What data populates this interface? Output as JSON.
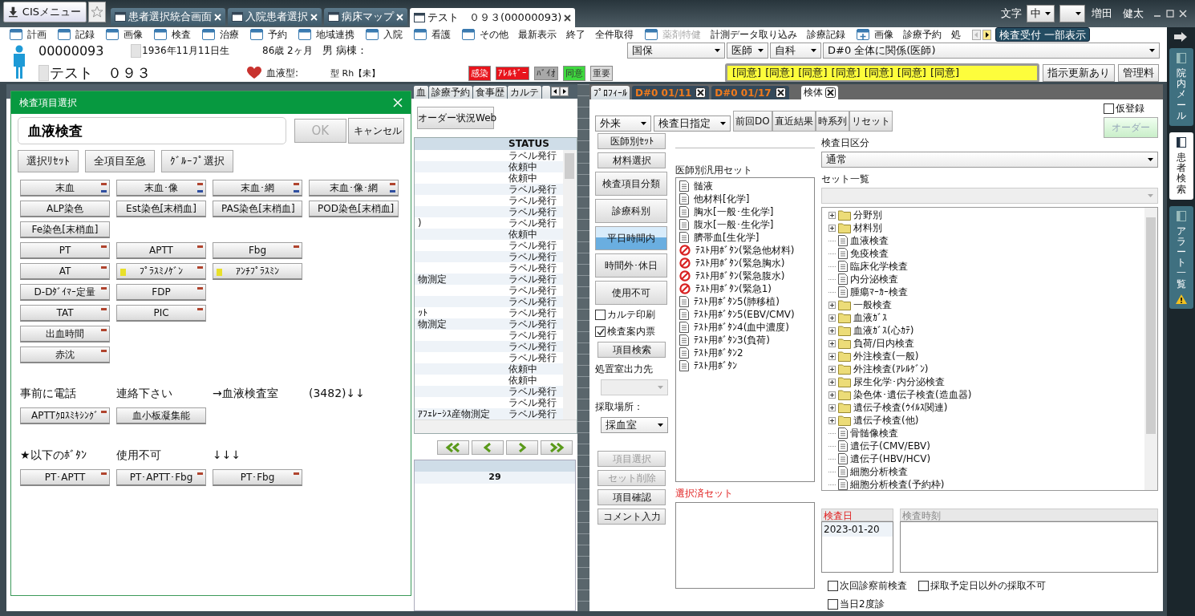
{
  "title_bar": {
    "menu_button": "CISメニュー",
    "tabs": [
      {
        "label": "患者選択統合画面",
        "selected": false
      },
      {
        "label": "入院患者選択",
        "selected": false
      },
      {
        "label": "病床マップ",
        "selected": false
      },
      {
        "label": "テスト　０９３(00000093)",
        "selected": true
      }
    ],
    "font_label": "文字",
    "font_size": "中",
    "user": "増田　健太"
  },
  "menu": [
    {
      "label": "計画",
      "kind": "window",
      "disabled": false
    },
    {
      "label": "記録",
      "kind": "window",
      "disabled": false
    },
    {
      "label": "画像",
      "kind": "window",
      "disabled": false
    },
    {
      "label": "検査",
      "kind": "window",
      "disabled": false
    },
    {
      "label": "治療",
      "kind": "window",
      "disabled": false
    },
    {
      "label": "予約",
      "kind": "window",
      "disabled": false
    },
    {
      "label": "地域連携",
      "kind": "window",
      "disabled": false
    },
    {
      "label": "入院",
      "kind": "window",
      "disabled": false
    },
    {
      "label": "看護",
      "kind": "window",
      "disabled": false
    },
    {
      "label": "その他",
      "kind": "window",
      "disabled": false
    },
    {
      "label": "最新表示",
      "kind": "text",
      "disabled": false
    },
    {
      "label": "終了",
      "kind": "text",
      "disabled": false
    },
    {
      "label": "全件取得",
      "kind": "text",
      "disabled": false
    },
    {
      "label": "薬剤特健",
      "kind": "window",
      "disabled": true
    },
    {
      "label": "計測データ取り込み",
      "kind": "text",
      "disabled": false
    },
    {
      "label": "診療記録",
      "kind": "text",
      "disabled": false
    },
    {
      "label": "画像",
      "kind": "plus",
      "disabled": false
    },
    {
      "label": "診療予約",
      "kind": "text",
      "disabled": false
    },
    {
      "label": "処",
      "kind": "text",
      "disabled": false
    }
  ],
  "menu_action": "検査受付 一部表示",
  "patient": {
    "id": "00000093",
    "birth": "1936年11月11日生",
    "age": "86歳 2ヶ月",
    "sex_ward": "男 病棟：",
    "name": "テスト　０９３",
    "blood_label": "血液型:",
    "blood": "型 Rh【未】",
    "badges": [
      {
        "label": "感染",
        "color": "#e8141c"
      },
      {
        "label": "ｱﾚﾙｷﾞｰ",
        "color": "#e8141c"
      },
      {
        "label": "ﾊﾞｲｵ",
        "color": "#a8a8a8"
      },
      {
        "label": "同意",
        "color": "#3ed83e"
      },
      {
        "label": "重要",
        "color": "#dcdcdc"
      }
    ]
  },
  "selectors": [
    "国保",
    "医師",
    "自科",
    "D#0  全体に関係(医師)"
  ],
  "consents": [
    "[同意]",
    "[同意]",
    "[同意]",
    "[同意]",
    "[同意]",
    "[同意]",
    "[同意]"
  ],
  "header_buttons": [
    "指示更新あり",
    "管理料"
  ],
  "left_panel": {
    "tabs": [
      "血",
      "診療予約",
      "食事歴",
      "カルテ"
    ],
    "order_web_button": "オーダー状況Web",
    "table": {
      "status_heading": "STATUS",
      "rows": [
        {
          "status": "ラベル発行"
        },
        {
          "status": "依頼中"
        },
        {
          "status": "依頼中"
        },
        {
          "status": "ラベル発行"
        },
        {
          "status": "ラベル発行"
        },
        {
          "status": "ラベル発行"
        },
        {
          "column_1": ")",
          "status": "ラベル発行"
        },
        {
          "status": "依頼中"
        },
        {
          "status": "ラベル発行"
        },
        {
          "status": "ラベル発行"
        },
        {
          "status": "ラベル発行"
        },
        {
          "column_1": "物測定",
          "status": "ラベル発行"
        },
        {
          "status": "ラベル発行"
        },
        {
          "status": "ラベル発行"
        },
        {
          "column_1": "ｯﾄ",
          "status": "ラベル発行"
        },
        {
          "column_1": "物測定",
          "status": "ラベル発行"
        },
        {
          "status": "ラベル発行"
        },
        {
          "status": "ラベル発行"
        },
        {
          "status": "ラベル発行"
        },
        {
          "status": "依頼中"
        },
        {
          "status": "依頼中"
        },
        {
          "status": "ラベル発行"
        },
        {
          "status": "ラベル発行"
        },
        {
          "column_1": "ｱﾌｪﾚｰｼｽ産物測定",
          "status": "ラベル発行"
        }
      ]
    },
    "bottom_table": {
      "rows": [
        {
          "column_2": "29"
        }
      ]
    }
  },
  "dialog": {
    "title": "検査項目選択",
    "search_value": "血液検査",
    "ok": "OK",
    "cancel": "キャンセル",
    "tools": [
      "選択ﾘｾｯﾄ",
      "全項目至急",
      "ｸﾞﾙｰﾌﾟ選択"
    ],
    "grid": [
      [
        {
          "label": "末血",
          "top_mark": true,
          "bottom_mark": true,
          "side_mark": false
        },
        {
          "label": "末血･像",
          "top_mark": true,
          "bottom_mark": true,
          "side_mark": false
        },
        {
          "label": "末血･網",
          "top_mark": true,
          "bottom_mark": true,
          "side_mark": false
        },
        {
          "label": "末血･像･網",
          "top_mark": true,
          "bottom_mark": true,
          "side_mark": false
        }
      ],
      [
        {
          "label": "ALP染色",
          "top_mark": false,
          "bottom_mark": false,
          "side_mark": false
        },
        {
          "label": "Est染色[末梢血]",
          "top_mark": false,
          "bottom_mark": false,
          "side_mark": false
        },
        {
          "label": "PAS染色[末梢血]",
          "top_mark": false,
          "bottom_mark": false,
          "side_mark": false
        },
        {
          "label": "POD染色[末梢血]",
          "top_mark": false,
          "bottom_mark": false,
          "side_mark": false
        }
      ],
      [
        {
          "label": "Fe染色[末梢血]",
          "top_mark": false,
          "bottom_mark": false,
          "side_mark": false
        }
      ],
      [
        {
          "label": "PT",
          "top_mark": true,
          "bottom_mark": false,
          "side_mark": false
        },
        {
          "label": "APTT",
          "top_mark": true,
          "bottom_mark": false,
          "side_mark": false
        },
        {
          "label": "Fbg",
          "top_mark": true,
          "bottom_mark": false,
          "side_mark": false
        }
      ],
      [
        {
          "label": "AT",
          "top_mark": true,
          "bottom_mark": false,
          "side_mark": false
        },
        {
          "label": "ﾌﾟﾗｽﾐﾉｹﾞﾝ",
          "top_mark": true,
          "bottom_mark": false,
          "side_mark": true
        },
        {
          "label": "ｱﾝﾁﾌﾟﾗｽﾐﾝ",
          "top_mark": false,
          "bottom_mark": false,
          "side_mark": true
        }
      ],
      [
        {
          "label": "D-Dﾀﾞｲﾏｰ定量",
          "top_mark": true,
          "bottom_mark": false,
          "side_mark": false
        },
        {
          "label": "FDP",
          "top_mark": true,
          "bottom_mark": false,
          "side_mark": false
        }
      ],
      [
        {
          "label": "TAT",
          "top_mark": true,
          "bottom_mark": false,
          "side_mark": false
        },
        {
          "label": "PIC",
          "top_mark": true,
          "bottom_mark": false,
          "side_mark": false
        }
      ],
      [
        {
          "label": "出血時間",
          "top_mark": true,
          "bottom_mark": false,
          "side_mark": false
        }
      ],
      [
        {
          "label": "赤沈",
          "top_mark": true,
          "bottom_mark": false,
          "side_mark": false
        }
      ]
    ],
    "notes": [
      {
        "labels": [
          "事前に電話",
          "連絡下さい",
          "→血液検査室",
          "(3482)↓↓"
        ],
        "buttons": [
          {
            "label": "APTTｸﾛｽﾐｷｼﾝｸﾞ",
            "top_mark": true,
            "bottom_mark": false,
            "side_mark": false
          },
          {
            "label": "血小板凝集能",
            "top_mark": false,
            "bottom_mark": false,
            "side_mark": false
          }
        ]
      },
      {
        "labels": [
          "★以下のﾎﾞﾀﾝ",
          "使用不可",
          "↓↓↓"
        ],
        "buttons": [
          {
            "label": "PT･APTT",
            "top_mark": true,
            "bottom_mark": false,
            "side_mark": false
          },
          {
            "label": "PT･APTT･Fbg",
            "top_mark": true,
            "bottom_mark": false,
            "side_mark": false
          },
          {
            "label": "PT･Fbg",
            "top_mark": true,
            "bottom_mark": false,
            "side_mark": false
          }
        ]
      }
    ]
  },
  "right_panel": {
    "tabs": [
      {
        "label": "ﾌﾟﾛﾌｨｰﾙ",
        "kind": "plain",
        "closable": false,
        "selected": false
      },
      {
        "label": "D#0 01/11",
        "kind": "record",
        "closable": true,
        "selected": false
      },
      {
        "label": "D#0 01/17",
        "kind": "record",
        "closable": true,
        "selected": false
      },
      {
        "label": "検体",
        "kind": "plain",
        "closable": true,
        "selected": true
      }
    ],
    "top_selects": [
      "外来",
      "検査日指定"
    ],
    "top_buttons": [
      "前回DO",
      "直近結果",
      "時系列",
      "リセット"
    ],
    "provisional": {
      "label": "仮登録",
      "checked": false
    },
    "order_button": {
      "label": "オーダー",
      "disabled": true
    },
    "controls": [
      {
        "kind": "button",
        "label": "医師別ｾｯﾄ",
        "disabled": false
      },
      {
        "kind": "button",
        "label": "材料選択",
        "disabled": false
      },
      {
        "kind": "large_button",
        "label": "検査項目分類",
        "selected": false
      },
      {
        "kind": "large_button",
        "label": "診療科別",
        "selected": false
      },
      {
        "kind": "large_button",
        "label": "平日時間内",
        "selected": true
      },
      {
        "kind": "large_button",
        "label": "時間外･休日",
        "selected": false
      },
      {
        "kind": "large_button",
        "label": "使用不可",
        "selected": false
      },
      {
        "kind": "checkbox",
        "label": "カルテ印刷",
        "checked": false
      },
      {
        "kind": "checkbox",
        "label": "検査案内票",
        "checked": true
      },
      {
        "kind": "button",
        "label": "項目検索",
        "disabled": false
      },
      {
        "kind": "label",
        "label": "処置室出力先"
      },
      {
        "kind": "dropdown",
        "disabled": true
      },
      {
        "kind": "label",
        "label": "採取場所："
      },
      {
        "kind": "dropdown",
        "value": "採血室",
        "disabled": false
      },
      {
        "kind": "gap"
      },
      {
        "kind": "button",
        "label": "項目選択",
        "disabled": true
      },
      {
        "kind": "button",
        "label": "セット削除",
        "disabled": true
      },
      {
        "kind": "button",
        "label": "項目確認",
        "disabled": false
      },
      {
        "kind": "button",
        "label": "コメント入力",
        "disabled": false
      }
    ],
    "set_label": "医師別汎用セット",
    "sets": [
      {
        "label": "髄液",
        "kind": "doc"
      },
      {
        "label": "他材料[化学]",
        "kind": "doc"
      },
      {
        "label": "胸水[一般･生化学]",
        "kind": "doc"
      },
      {
        "label": "腹水[一般･生化学]",
        "kind": "doc"
      },
      {
        "label": "臍帯血[生化学]",
        "kind": "doc"
      },
      {
        "label": "ﾃｽﾄ用ﾎﾞﾀﾝ(緊急他材料)",
        "kind": "blocked"
      },
      {
        "label": "ﾃｽﾄ用ﾎﾞﾀﾝ(緊急胸水)",
        "kind": "blocked"
      },
      {
        "label": "ﾃｽﾄ用ﾎﾞﾀﾝ(緊急腹水)",
        "kind": "blocked"
      },
      {
        "label": "ﾃｽﾄ用ﾎﾞﾀﾝ(緊急1)",
        "kind": "blocked"
      },
      {
        "label": "ﾃｽﾄ用ﾎﾞﾀﾝ5(肺移植)",
        "kind": "doc"
      },
      {
        "label": "ﾃｽﾄ用ﾎﾞﾀﾝ5(EBV/CMV)",
        "kind": "doc"
      },
      {
        "label": "ﾃｽﾄ用ﾎﾞﾀﾝ4(血中濃度)",
        "kind": "doc"
      },
      {
        "label": "ﾃｽﾄ用ﾎﾞﾀﾝ3(負荷)",
        "kind": "doc"
      },
      {
        "label": "ﾃｽﾄ用ﾎﾞﾀﾝ2",
        "kind": "doc"
      },
      {
        "label": "ﾃｽﾄ用ﾎﾞﾀﾝ",
        "kind": "doc"
      }
    ],
    "selected_label": "選択済セット",
    "day_label": "検査日区分",
    "day_value": "通常",
    "set_list_label": "セット一覧",
    "tree": [
      {
        "label": "分野別",
        "kind": "folder",
        "expanded": false
      },
      {
        "label": "材料別",
        "kind": "folder",
        "expanded": false
      },
      {
        "label": "血液検査",
        "kind": "doc"
      },
      {
        "label": "免疫検査",
        "kind": "doc"
      },
      {
        "label": "臨床化学検査",
        "kind": "doc"
      },
      {
        "label": "内分泌検査",
        "kind": "doc"
      },
      {
        "label": "腫瘍ﾏｰｶｰ検査",
        "kind": "doc"
      },
      {
        "label": "一般検査",
        "kind": "folder",
        "expanded": false
      },
      {
        "label": "血液ｶﾞｽ",
        "kind": "folder",
        "expanded": false
      },
      {
        "label": "血液ｶﾞｽ(心ｶﾃ)",
        "kind": "folder",
        "expanded": false
      },
      {
        "label": "負荷/日内検査",
        "kind": "folder",
        "expanded": false
      },
      {
        "label": "外注検査(一般)",
        "kind": "folder",
        "expanded": false
      },
      {
        "label": "外注検査(ｱﾚﾙｹﾞﾝ)",
        "kind": "folder",
        "expanded": false
      },
      {
        "label": "尿生化学･内分泌検査",
        "kind": "folder",
        "expanded": false
      },
      {
        "label": "染色体･遺伝子検査(造血器)",
        "kind": "folder",
        "expanded": false
      },
      {
        "label": "遺伝子検査(ｳｲﾙｽ関連)",
        "kind": "folder",
        "expanded": false
      },
      {
        "label": "遺伝子検査(他)",
        "kind": "folder",
        "expanded": false
      },
      {
        "label": "骨髄像検査",
        "kind": "doc"
      },
      {
        "label": "遺伝子(CMV/EBV)",
        "kind": "doc"
      },
      {
        "label": "遺伝子(HBV/HCV)",
        "kind": "doc"
      },
      {
        "label": "細胞分析検査",
        "kind": "doc"
      },
      {
        "label": "細胞分析検査(予約枠)",
        "kind": "doc"
      }
    ],
    "date_table": {
      "columns": [
        "検査日",
        "検査時刻"
      ],
      "rows": [
        {
          "date": "2023-01-20"
        }
      ]
    },
    "options": [
      {
        "label": "次回診察前検査",
        "checked": false
      },
      {
        "label": "採取予定日以外の採取不可",
        "checked": false
      },
      {
        "label": "当日2度診",
        "checked": false
      }
    ]
  },
  "side_tabs": [
    {
      "label": "院内メール",
      "selected": false,
      "alert": false
    },
    {
      "label": "患者検索",
      "selected": true,
      "alert": false
    },
    {
      "label": "アラート一覧",
      "selected": false,
      "alert": true
    }
  ]
}
